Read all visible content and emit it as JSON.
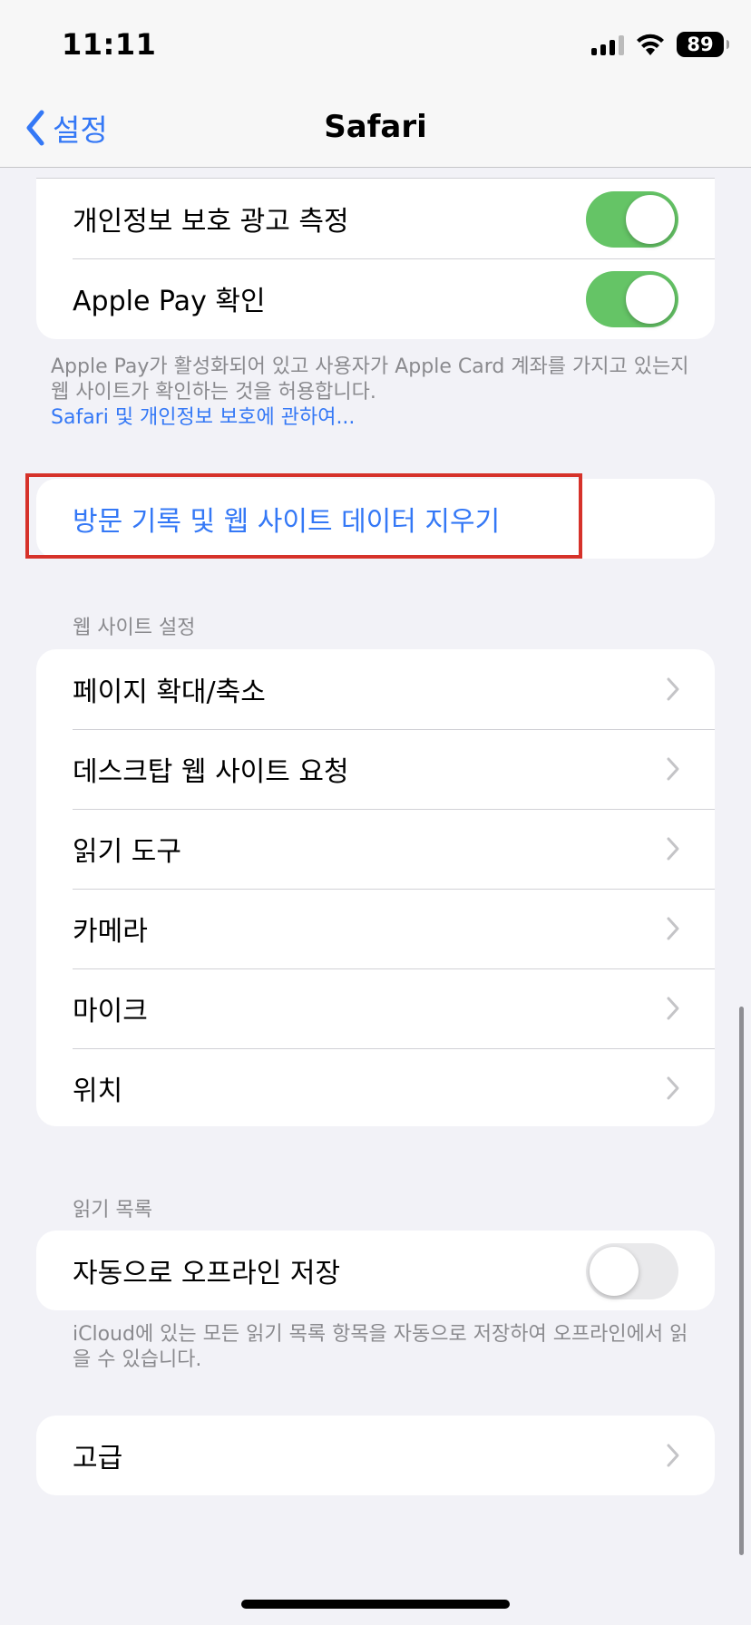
{
  "status_bar": {
    "time": "11:11",
    "battery": "89",
    "icons": [
      "cellular-signal-icon",
      "wifi-icon",
      "battery-icon"
    ]
  },
  "nav": {
    "back_label": "설정",
    "title": "Safari"
  },
  "privacy_group": {
    "items": [
      {
        "label": "개인정보 보호 광고 측정",
        "toggle": "on"
      },
      {
        "label": "Apple Pay 확인",
        "toggle": "on"
      }
    ],
    "footer": "Apple Pay가 활성화되어 있고 사용자가 Apple Card 계좌를 가지고 있는지 웹 사이트가 확인하는 것을 허용합니다.",
    "footer_link": "Safari 및 개인정보 보호에 관하여..."
  },
  "clear_history": {
    "label": "방문 기록 및 웹 사이트 데이터 지우기"
  },
  "website_settings": {
    "header": "웹 사이트 설정",
    "items": [
      "페이지 확대/축소",
      "데스크탑 웹 사이트 요청",
      "읽기 도구",
      "카메라",
      "마이크",
      "위치"
    ]
  },
  "reading_list": {
    "header": "읽기 목록",
    "item": {
      "label": "자동으로 오프라인 저장",
      "toggle": "off"
    },
    "footer": "iCloud에 있는 모든 읽기 목록 항목을 자동으로 저장하여 오프라인에서 읽을 수 있습니다."
  },
  "advanced": {
    "label": "고급"
  },
  "colors": {
    "accent": "#3478f6",
    "toggle_on": "#65c466",
    "highlight_box": "#d6322a",
    "background": "#f2f2f7"
  }
}
